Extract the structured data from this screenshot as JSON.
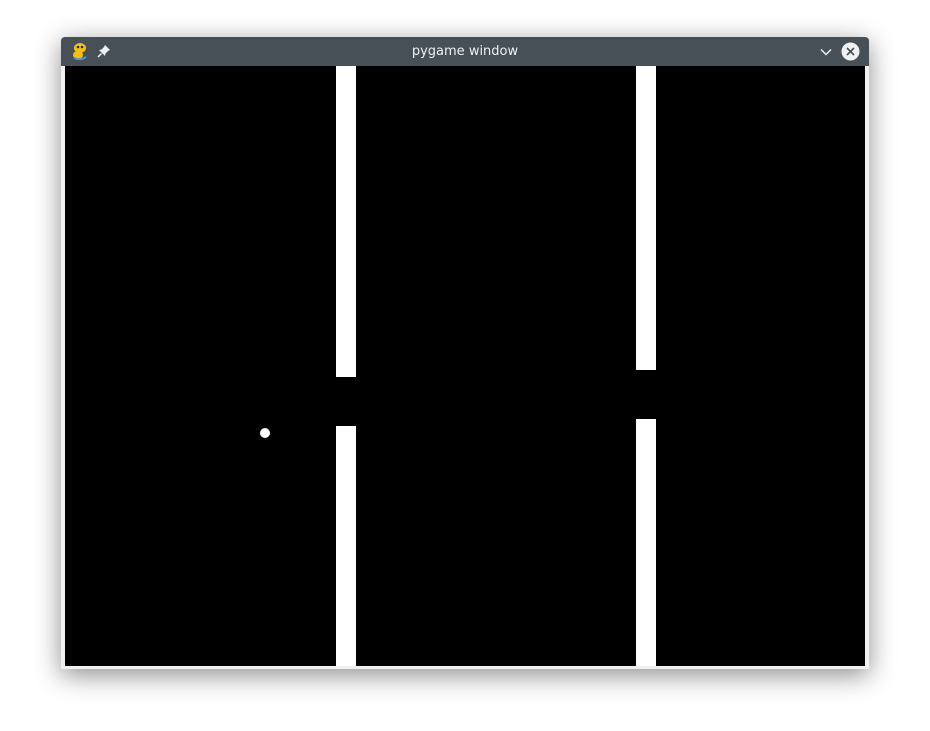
{
  "window": {
    "title": "pygame window"
  },
  "icons": {
    "app": "pygame-snake-icon",
    "pin": "pin-icon",
    "minimize": "chevron-down-icon",
    "close": "close-icon"
  },
  "colors": {
    "titlebar": "#475057",
    "title_text": "#eff0f1",
    "canvas_background": "#000000",
    "pipe": "#ffffff",
    "bird": "#ffffff"
  }
}
